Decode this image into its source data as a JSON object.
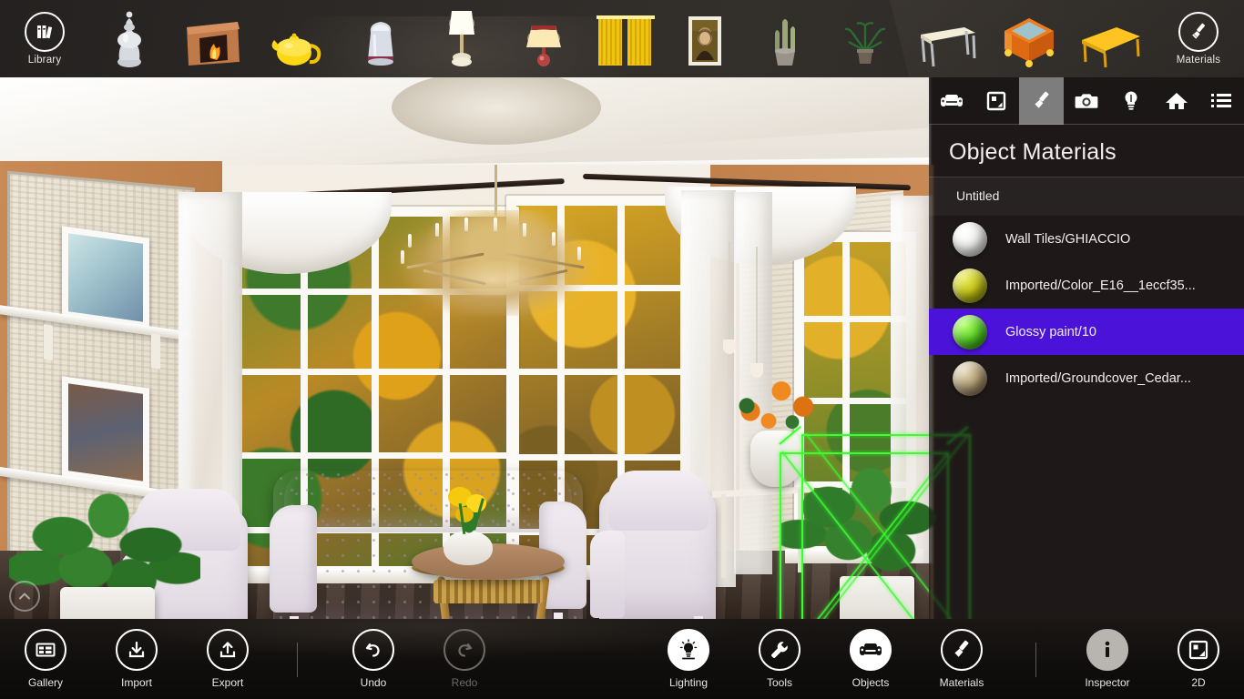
{
  "top_toolbar": {
    "library": {
      "label": "Library",
      "icon": "library-books-icon"
    },
    "materials": {
      "label": "Materials",
      "icon": "paint-brush-icon"
    },
    "objects": [
      {
        "name": "silver-vase-thumbnail",
        "label": "Silver Vase"
      },
      {
        "name": "fireplace-thumbnail",
        "label": "Fireplace"
      },
      {
        "name": "yellow-teapot-thumbnail",
        "label": "Yellow Teapot"
      },
      {
        "name": "white-jug-thumbnail",
        "label": "White Jug"
      },
      {
        "name": "table-lamp-thumbnail",
        "label": "Table Lamp"
      },
      {
        "name": "wall-sconce-thumbnail",
        "label": "Wall Sconce"
      },
      {
        "name": "yellow-curtains-thumbnail",
        "label": "Yellow Curtains"
      },
      {
        "name": "mona-lisa-painting-thumbnail",
        "label": "Framed Painting"
      },
      {
        "name": "cactus-plant-thumbnail",
        "label": "Cactus Plant"
      },
      {
        "name": "potted-plant-thumbnail",
        "label": "Potted Plant"
      },
      {
        "name": "white-table-thumbnail",
        "label": "White Table"
      },
      {
        "name": "orange-table-thumbnail",
        "label": "Orange Table"
      },
      {
        "name": "yellow-table-thumbnail",
        "label": "Yellow Table"
      }
    ]
  },
  "right_panel": {
    "title": "Object Materials",
    "group_label": "Untitled",
    "tabs": [
      {
        "name": "objects",
        "icon": "sofa-icon",
        "active": false
      },
      {
        "name": "floorplan",
        "icon": "floorplan-icon",
        "active": false
      },
      {
        "name": "materials",
        "icon": "paint-brush-icon",
        "active": true
      },
      {
        "name": "camera",
        "icon": "camera-icon",
        "active": false
      },
      {
        "name": "lighting",
        "icon": "lightbulb-icon",
        "active": false
      },
      {
        "name": "home",
        "icon": "home-icon",
        "active": false
      },
      {
        "name": "list",
        "icon": "list-icon",
        "active": false
      }
    ],
    "materials": [
      {
        "label": "Wall Tiles/GHIACCIO",
        "color": "#f2f2f0",
        "selected": false
      },
      {
        "label": "Imported/Color_E16__1eccf35...",
        "color": "#c8c81a",
        "selected": false
      },
      {
        "label": "Glossy paint/10",
        "color": "#5ed62a",
        "selected": true
      },
      {
        "label": "Imported/Groundcover_Cedar...",
        "color": "#b8a27a",
        "selected": false
      }
    ],
    "selection_color": "#4b12d9"
  },
  "viewport": {
    "collapse_button": {
      "name": "collapse-toolbar-button",
      "icon": "chevron-up-icon"
    },
    "scene_description": "3D interior living room render with chandelier, bay windows, sofa, armchairs, coffee table and potted plants",
    "selection_wireframe_color": "#39ff2e"
  },
  "bottom_bar": {
    "items": [
      {
        "name": "gallery",
        "label": "Gallery",
        "icon": "gallery-icon",
        "style": "outline",
        "enabled": true
      },
      {
        "name": "import",
        "label": "Import",
        "icon": "download-icon",
        "style": "outline",
        "enabled": true
      },
      {
        "name": "export",
        "label": "Export",
        "icon": "upload-icon",
        "style": "outline",
        "enabled": true
      },
      {
        "name": "undo",
        "label": "Undo",
        "icon": "undo-arrow-icon",
        "style": "outline",
        "enabled": true
      },
      {
        "name": "redo",
        "label": "Redo",
        "icon": "redo-arrow-icon",
        "style": "disabled",
        "enabled": false
      },
      {
        "name": "lighting",
        "label": "Lighting",
        "icon": "lightbulb-icon",
        "style": "filled",
        "enabled": true
      },
      {
        "name": "tools",
        "label": "Tools",
        "icon": "wrench-icon",
        "style": "outline",
        "enabled": true
      },
      {
        "name": "objects",
        "label": "Objects",
        "icon": "sofa-icon",
        "style": "filled",
        "enabled": true
      },
      {
        "name": "materials",
        "label": "Materials",
        "icon": "paint-brush-icon",
        "style": "outline",
        "enabled": true
      },
      {
        "name": "inspector",
        "label": "Inspector",
        "icon": "info-icon",
        "style": "greyfill",
        "enabled": true
      },
      {
        "name": "2d",
        "label": "2D",
        "icon": "floorplan-icon",
        "style": "outline",
        "enabled": true
      }
    ]
  }
}
